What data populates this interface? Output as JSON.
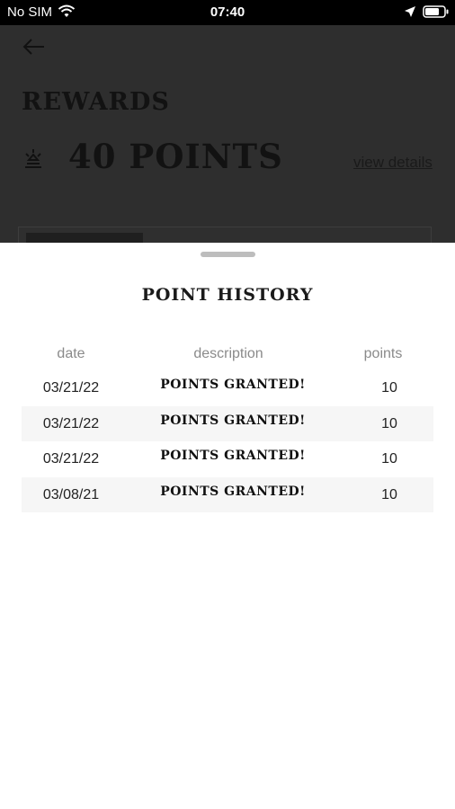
{
  "status_bar": {
    "carrier": "No SIM",
    "time": "07:40"
  },
  "background": {
    "title": "REWARDS",
    "points_total": "40 POINTS",
    "view_details": "view details"
  },
  "sheet": {
    "title": "POINT HISTORY",
    "columns": {
      "date": "date",
      "description": "description",
      "points": "points"
    },
    "rows": [
      {
        "date": "03/21/22",
        "description": "POINTS GRANTED!",
        "points": "10"
      },
      {
        "date": "03/21/22",
        "description": "POINTS GRANTED!",
        "points": "10"
      },
      {
        "date": "03/21/22",
        "description": "POINTS GRANTED!",
        "points": "10"
      },
      {
        "date": "03/08/21",
        "description": "POINTS GRANTED!",
        "points": "10"
      }
    ]
  },
  "colors": {
    "sheet_bg": "#ffffff",
    "overlay": "#2e2e2e",
    "alt_row": "#f6f6f6",
    "header_text": "#8a8a8a"
  }
}
